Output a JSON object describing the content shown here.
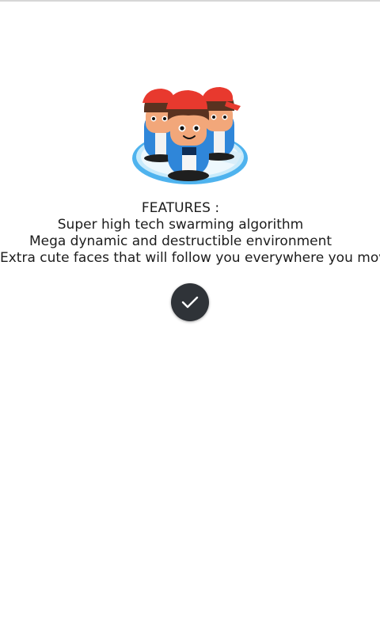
{
  "onboarding": {
    "image": {
      "icon": "three-crowd-characters-illustration",
      "colors": {
        "cap": "#e8392e",
        "skin": "#f2a77a",
        "hair": "#5a3220",
        "shirt": "#2f86d9",
        "platform": "#9fd6f5",
        "platform_rim": "#4fb3ee"
      }
    },
    "features": {
      "heading": "FEATURES :",
      "lines": [
        "Super high tech swarming algorithm",
        "Mega dynamic and destructible environment",
        "Extra cute faces that will follow you everywhere you move"
      ]
    },
    "confirm": {
      "icon": "checkmark-icon",
      "color": "#2f3338"
    }
  }
}
